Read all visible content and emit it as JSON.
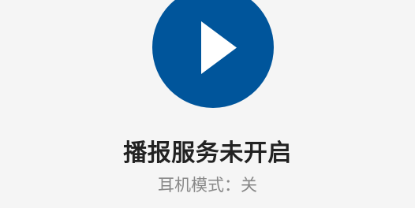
{
  "play_button": {
    "icon": "play-icon",
    "color": "#00559b"
  },
  "status": {
    "title": "播报服务未开启",
    "earphone_mode": "耳机模式：关"
  }
}
